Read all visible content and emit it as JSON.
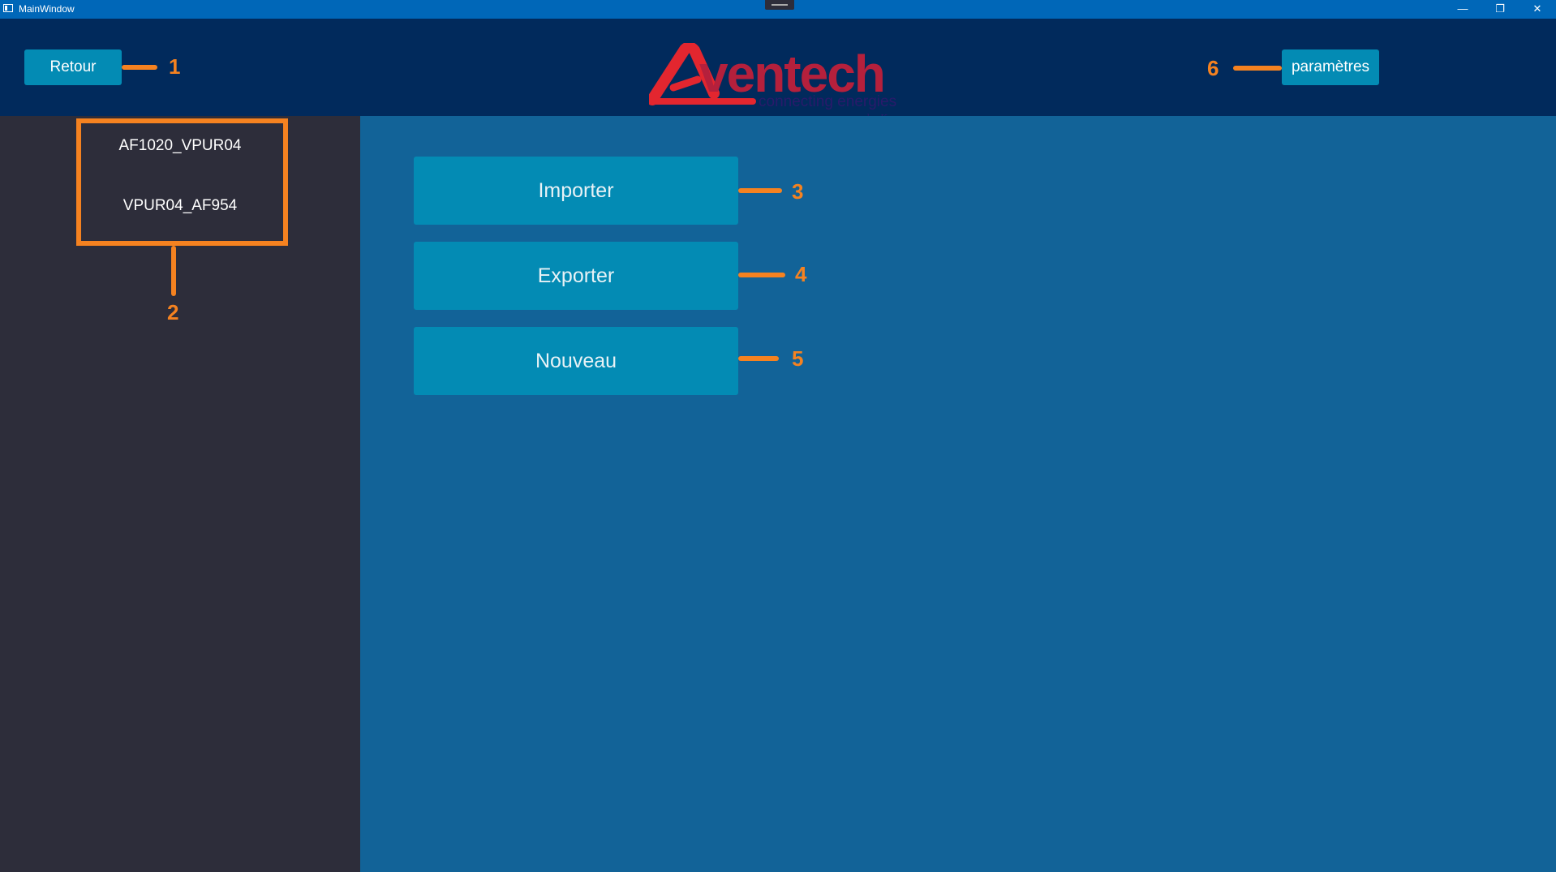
{
  "window": {
    "title": "MainWindow",
    "controls": {
      "minimize": "—",
      "restore": "❐",
      "close": "✕"
    }
  },
  "header": {
    "back_label": "Retour",
    "settings_label": "paramètres",
    "logo": {
      "brand": "Aventech",
      "tagline": "connecting energies",
      "byline": "by Kryos"
    }
  },
  "sidebar": {
    "items": [
      {
        "label": "AF1020_VPUR04"
      },
      {
        "label": "VPUR04_AF954"
      }
    ]
  },
  "main": {
    "import_label": "Importer",
    "export_label": "Exporter",
    "new_label": "Nouveau"
  },
  "annotations": [
    "1",
    "2",
    "3",
    "4",
    "5",
    "6"
  ],
  "colors": {
    "accent_button": "#038bb4",
    "header_bg": "#012a5c",
    "main_bg": "#126398",
    "sidebar_bg": "#2d2d3a",
    "annotation": "#f58220",
    "logo_red": "#e3262f",
    "logo_navy": "#2a1a6b"
  }
}
